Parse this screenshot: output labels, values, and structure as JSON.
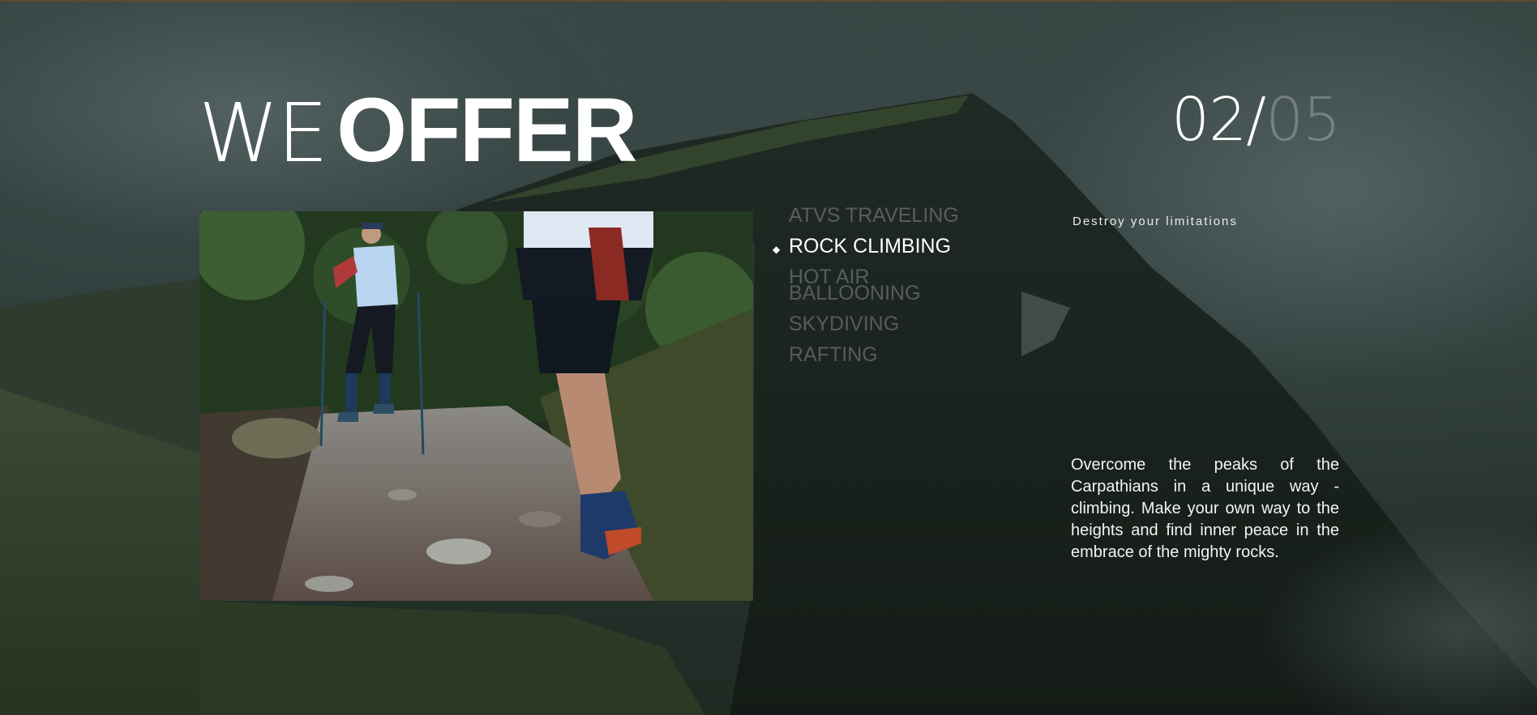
{
  "heading": {
    "thin": "WE",
    "bold": "OFFER"
  },
  "counter": {
    "current": "02/",
    "total": "05"
  },
  "activities": [
    {
      "label": "ATVS TRAVELING",
      "active": false
    },
    {
      "label": "ROCK CLIMBING",
      "active": true
    },
    {
      "label": "HOT AIR BALLOONING",
      "active": false
    },
    {
      "label": "SKYDIVING",
      "active": false
    },
    {
      "label": "RAFTING",
      "active": false
    }
  ],
  "active_bullet": "◆",
  "tagline": "Destroy your limitations",
  "description": "Overcome the peaks of the Carpathians in a unique way - climbing. Make your own way to the heights and find inner peace in the embrace of the mighty rocks.",
  "colors": {
    "background": "#24302f",
    "text": "#ffffff",
    "inactive_text": "rgba(255,255,255,0.26)"
  },
  "photo": {
    "subject": "two trail runners on rocky forest path"
  }
}
